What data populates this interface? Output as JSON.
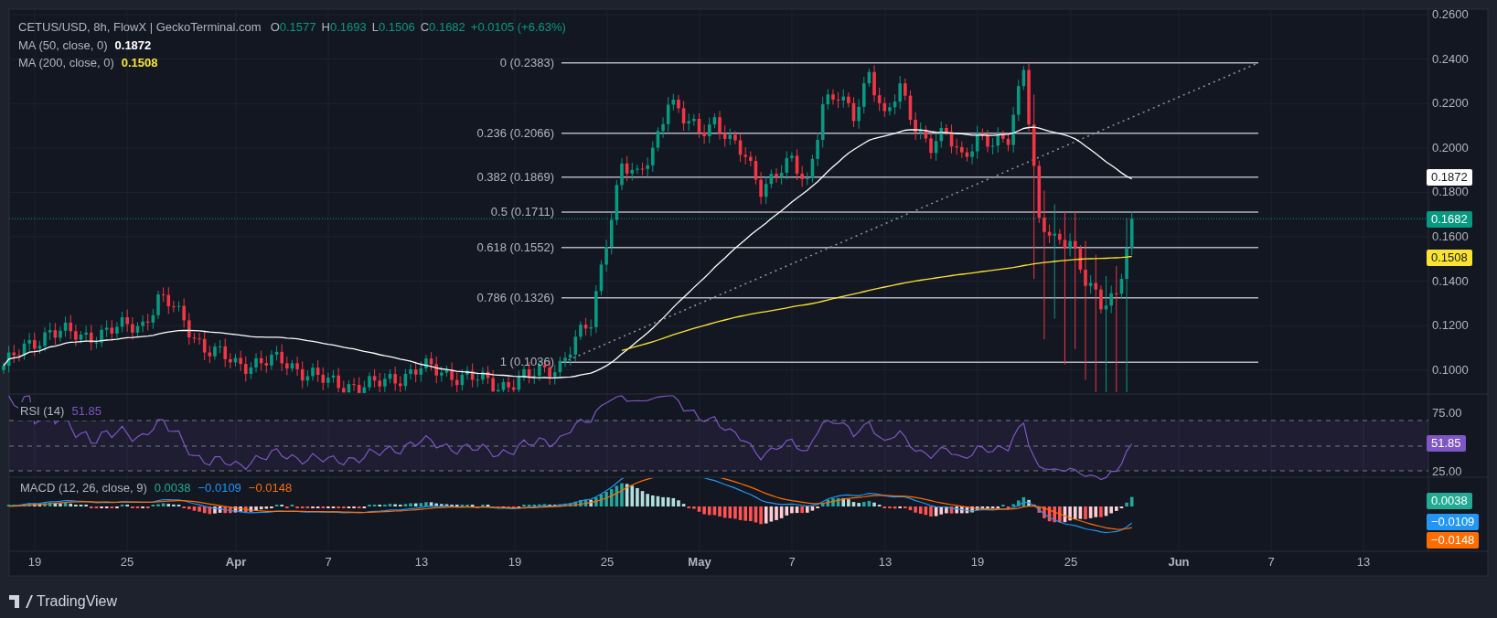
{
  "header": {
    "symbol": "CETUS/USD, 8h, FlowX | GeckoTerminal.com",
    "ohlc": [
      {
        "key": "O",
        "value": "0.1577"
      },
      {
        "key": "H",
        "value": "0.1693"
      },
      {
        "key": "L",
        "value": "0.1506"
      },
      {
        "key": "C",
        "value": "0.1682"
      }
    ],
    "change": "+0.0105 (+6.63%)"
  },
  "indicators": [
    {
      "label": "MA (50, close, 0)",
      "value": "0.1872",
      "color": "#ffffff"
    },
    {
      "label": "MA (200, close, 0)",
      "value": "0.1508",
      "color": "#fbe330"
    }
  ],
  "fib_levels": [
    {
      "label": "0 (0.2383)"
    },
    {
      "label": "0.236 (0.2066)"
    },
    {
      "label": "0.382 (0.1869)"
    },
    {
      "label": "0.5 (0.1711)"
    },
    {
      "label": "0.618 (0.1552)"
    },
    {
      "label": "0.786 (0.1326)"
    },
    {
      "label": "1 (0.1036)"
    }
  ],
  "price_axis": {
    "ticks": [
      "0.2600",
      "0.2400",
      "0.2200",
      "0.2000",
      "0.1800",
      "0.1600",
      "0.1400",
      "0.1200",
      "0.1000"
    ],
    "badges": [
      {
        "text": "0.1872",
        "color": "#ffffff"
      },
      {
        "text": "0.1682",
        "color": "#089981"
      },
      {
        "text": "0.1508",
        "color": "#fbe330"
      }
    ]
  },
  "rsi": {
    "label": "RSI (14)",
    "value": "51.85",
    "ticks": [
      "75.00",
      "25.00"
    ],
    "badge": {
      "text": "51.85",
      "color": "#7e57c2"
    }
  },
  "macd": {
    "label": "MACD (12, 26, close, 9)",
    "values": [
      {
        "text": "0.0038",
        "color": "#22ab94"
      },
      {
        "text": "−0.0109",
        "color": "#2196f3"
      },
      {
        "text": "−0.0148",
        "color": "#ff6d00"
      }
    ],
    "badges": [
      {
        "text": "0.0038",
        "color": "#22ab94"
      },
      {
        "text": "−0.0109",
        "color": "#2196f3"
      },
      {
        "text": "−0.0148",
        "color": "#ff6d00"
      }
    ]
  },
  "time_axis": [
    {
      "text": "19",
      "bold": false
    },
    {
      "text": "25",
      "bold": false
    },
    {
      "text": "Apr",
      "bold": true
    },
    {
      "text": "7",
      "bold": false
    },
    {
      "text": "13",
      "bold": false
    },
    {
      "text": "19",
      "bold": false
    },
    {
      "text": "25",
      "bold": false
    },
    {
      "text": "May",
      "bold": true
    },
    {
      "text": "7",
      "bold": false
    },
    {
      "text": "13",
      "bold": false
    },
    {
      "text": "19",
      "bold": false
    },
    {
      "text": "25",
      "bold": false
    },
    {
      "text": "Jun",
      "bold": true
    },
    {
      "text": "7",
      "bold": false
    },
    {
      "text": "13",
      "bold": false
    }
  ],
  "footer": {
    "brand": "TradingView"
  }
}
